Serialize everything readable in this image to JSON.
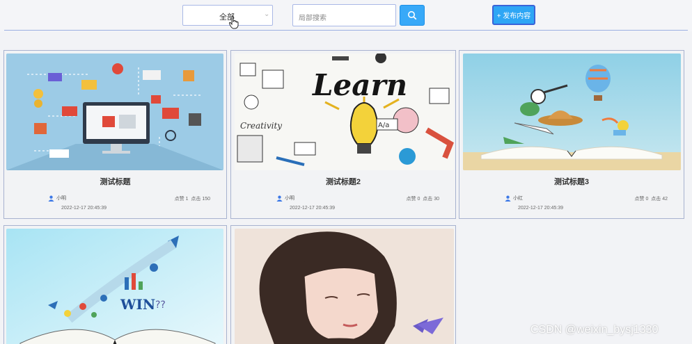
{
  "toolbar": {
    "category_select": {
      "value": "全部"
    },
    "search": {
      "placeholder": "局部搜索"
    },
    "publish_label": "+ 发布内容"
  },
  "cards": [
    {
      "title": "测试标题",
      "author": "小明",
      "likes_label": "点赞 1",
      "clicks_label": "点击 150",
      "date": "2022-12-17 20:45:39",
      "image": "computer-shopping-illustration"
    },
    {
      "title": "测试标题2",
      "author": "小明",
      "likes_label": "点赞 0",
      "clicks_label": "点击 30",
      "date": "2022-12-17 20:45:39",
      "image": "learn-lightbulb-illustration"
    },
    {
      "title": "测试标题3",
      "author": "小红",
      "likes_label": "点赞 0",
      "clicks_label": "点击 42",
      "date": "2022-12-17 20:45:39",
      "image": "book-travel-illustration"
    },
    {
      "image": "book-rocket-win-illustration"
    },
    {
      "image": "girl-portrait-illustration"
    }
  ],
  "watermark": "CSDN @weixin_bysj1330",
  "colors": {
    "accent": "#2ea6f5",
    "border": "#a9b8e6"
  }
}
